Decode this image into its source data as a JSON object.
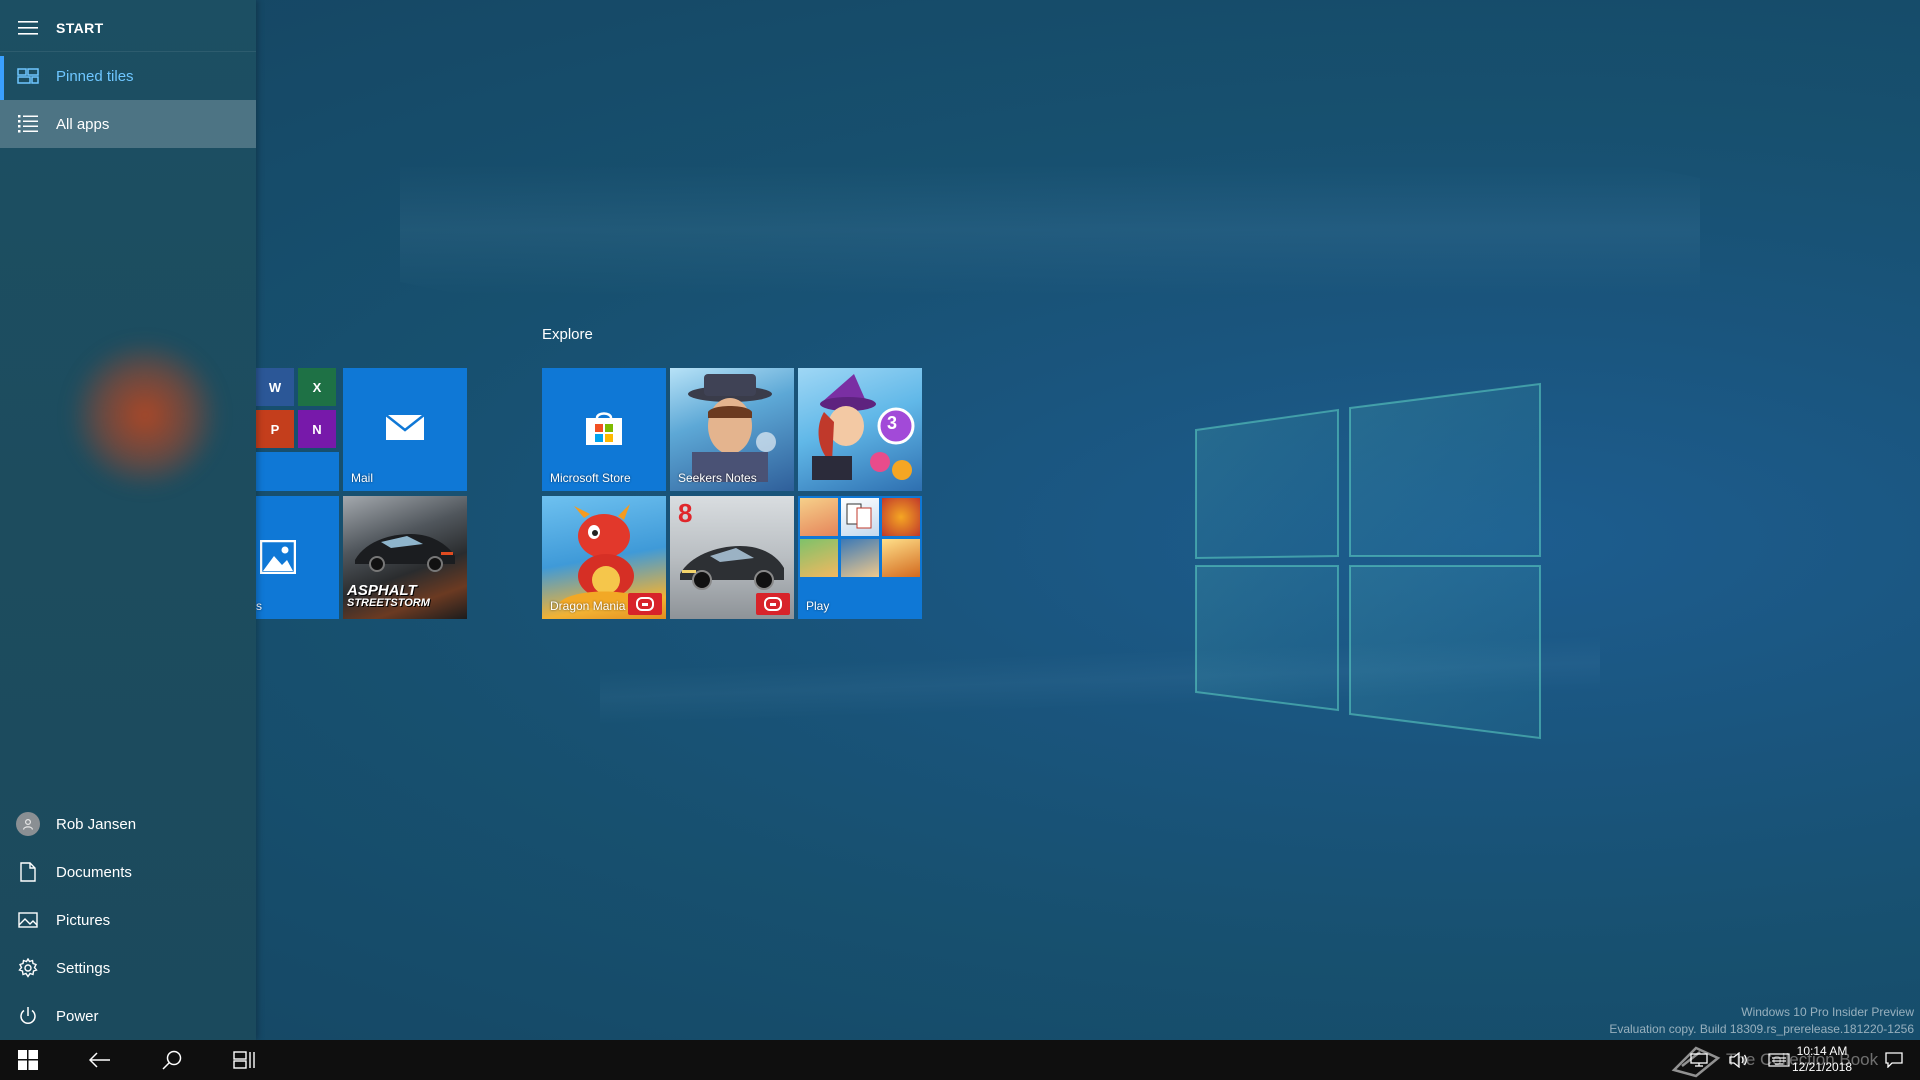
{
  "start": {
    "title": "START",
    "nav": {
      "pinned_label": "Pinned tiles",
      "allapps_label": "All apps"
    },
    "bottom": {
      "user_label": "Rob Jansen",
      "documents_label": "Documents",
      "pictures_label": "Pictures",
      "settings_label": "Settings",
      "power_label": "Power"
    }
  },
  "tiles": {
    "explore_title": "Explore",
    "mail_label": "Mail",
    "photos_label": "s",
    "store_label": "Microsoft Store",
    "seekers_label": "Seekers Notes",
    "dragon_label": "Dragon Mania",
    "play_label": "Play",
    "asphalt_line1": "ASPHALT",
    "asphalt_line2": "STREETSTORM",
    "office": {
      "word": "W",
      "excel": "X",
      "powerpoint": "P",
      "onenote": "N"
    },
    "game_numbers": {
      "bubble": "3",
      "asphalt8": "8"
    }
  },
  "taskbar": {
    "time": "10:14 AM",
    "date": "12/21/2018"
  },
  "watermark": {
    "line1": "Windows 10 Pro Insider Preview",
    "line2": "Evaluation copy. Build 18309.rs_prerelease.181220-1256",
    "overlay": "The Collection Book"
  },
  "colors": {
    "accent": "#0f78d6",
    "sidebar": "#1c4f63",
    "highlight_text": "#6ec6ff",
    "taskbar": "#0f0f0f"
  },
  "icons": {
    "header": "hamburger-icon",
    "pinned": "tiles-icon",
    "allapps": "list-icon",
    "documents": "document-icon",
    "pictures": "picture-icon",
    "settings": "gear-icon",
    "power": "power-icon"
  }
}
